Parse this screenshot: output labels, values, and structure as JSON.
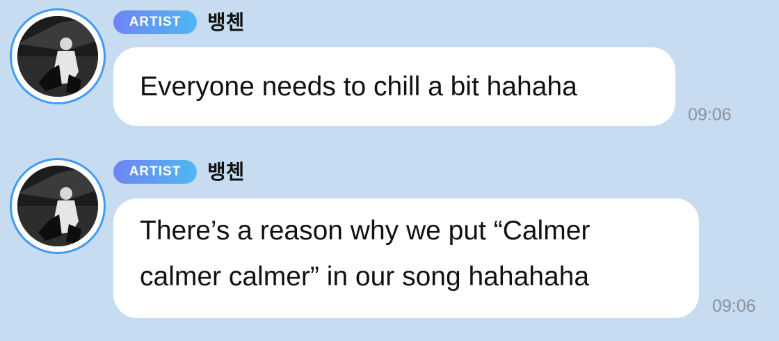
{
  "messages": [
    {
      "badge": "ARTIST",
      "sender": "뱅첸",
      "lines": [
        "Everyone needs to chill a bit hahaha"
      ],
      "time": "09:06"
    },
    {
      "badge": "ARTIST",
      "sender": "뱅첸",
      "lines": [
        "There’s a reason why we put “Calmer",
        "calmer calmer” in our song hahahaha"
      ],
      "time": "09:06"
    }
  ],
  "colors": {
    "background": "#c7dcf1",
    "bubble": "#ffffff",
    "avatar_ring": "#3f9af3",
    "badge_gradient_start": "#6f84f4",
    "badge_gradient_end": "#4fb8f2",
    "timestamp": "#8a9199"
  },
  "icons": {
    "avatar": "profile-photo"
  }
}
